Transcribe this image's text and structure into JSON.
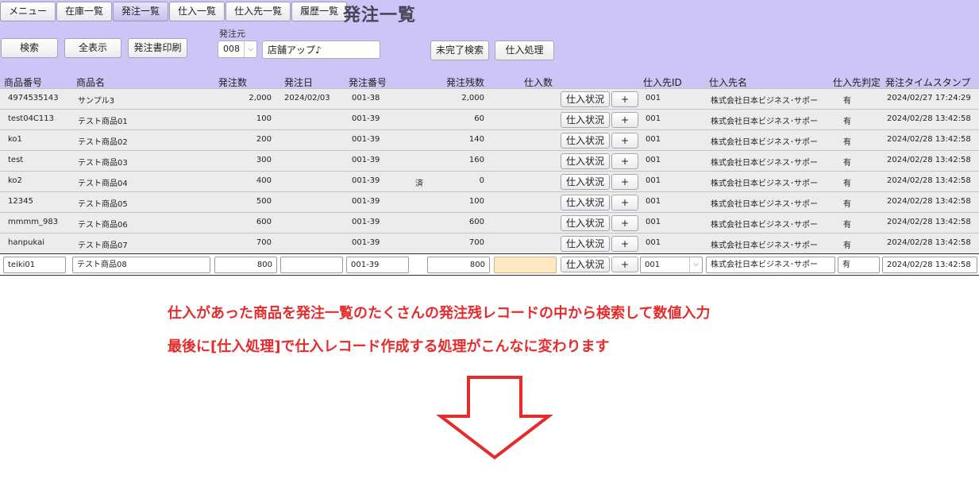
{
  "nav": {
    "tabs": [
      {
        "label": "メニュー"
      },
      {
        "label": "在庫一覧"
      },
      {
        "label": "発注一覧"
      },
      {
        "label": "仕入一覧"
      },
      {
        "label": "仕入先一覧"
      },
      {
        "label": "履歴一覧"
      }
    ]
  },
  "page": {
    "title": "発注一覧"
  },
  "toolbar": {
    "search": "検索",
    "show_all": "全表示",
    "print": "発注書印刷",
    "source_label": "発注元",
    "source_code": "008",
    "source_name": "店舗アップ♪",
    "incomplete_search": "未完了検索",
    "purchase_process": "仕入処理"
  },
  "columns": {
    "product_code": "商品番号",
    "product_name": "商品名",
    "order_qty": "発注数",
    "order_date": "発注日",
    "order_no": "発注番号",
    "remaining": "発注残数",
    "purchase_qty": "仕入数",
    "supplier_id": "仕入先ID",
    "supplier_name": "仕入先名",
    "supplier_flag": "仕入先判定",
    "timestamp": "発注タイムスタンプ"
  },
  "row_buttons": {
    "status": "仕入状況",
    "plus": "+"
  },
  "rows": [
    {
      "code": "4974535143",
      "name": "サンプル3",
      "qty": "2,000",
      "date": "2024/02/03",
      "order_no": "001-38",
      "done": "",
      "remain": "2,000",
      "sid": "001",
      "sname": "株式会社日本ビジネス･サポー",
      "flag": "有",
      "ts": "2024/02/27 17:24:29"
    },
    {
      "code": "test04C113",
      "name": "テスト商品01",
      "qty": "100",
      "date": "",
      "order_no": "001-39",
      "done": "",
      "remain": "60",
      "sid": "001",
      "sname": "株式会社日本ビジネス･サポー",
      "flag": "有",
      "ts": "2024/02/28 13:42:58"
    },
    {
      "code": "ko1",
      "name": "テスト商品02",
      "qty": "200",
      "date": "",
      "order_no": "001-39",
      "done": "",
      "remain": "140",
      "sid": "001",
      "sname": "株式会社日本ビジネス･サポー",
      "flag": "有",
      "ts": "2024/02/28 13:42:58"
    },
    {
      "code": "test",
      "name": "テスト商品03",
      "qty": "300",
      "date": "",
      "order_no": "001-39",
      "done": "",
      "remain": "160",
      "sid": "001",
      "sname": "株式会社日本ビジネス･サポー",
      "flag": "有",
      "ts": "2024/02/28 13:42:58"
    },
    {
      "code": "ko2",
      "name": "テスト商品04",
      "qty": "400",
      "date": "",
      "order_no": "001-39",
      "done": "済",
      "remain": "0",
      "sid": "001",
      "sname": "株式会社日本ビジネス･サポー",
      "flag": "有",
      "ts": "2024/02/28 13:42:58"
    },
    {
      "code": "12345",
      "name": "テスト商品05",
      "qty": "500",
      "date": "",
      "order_no": "001-39",
      "done": "",
      "remain": "100",
      "sid": "001",
      "sname": "株式会社日本ビジネス･サポー",
      "flag": "有",
      "ts": "2024/02/28 13:42:58"
    },
    {
      "code": "mmmm_983",
      "name": "テスト商品06",
      "qty": "600",
      "date": "",
      "order_no": "001-39",
      "done": "",
      "remain": "600",
      "sid": "001",
      "sname": "株式会社日本ビジネス･サポー",
      "flag": "有",
      "ts": "2024/02/28 13:42:58"
    },
    {
      "code": "hanpukai",
      "name": "テスト商品07",
      "qty": "700",
      "date": "",
      "order_no": "001-39",
      "done": "",
      "remain": "700",
      "sid": "001",
      "sname": "株式会社日本ビジネス･サポー",
      "flag": "有",
      "ts": "2024/02/28 13:42:58"
    }
  ],
  "edit_row": {
    "code": "teiki01",
    "name": "テスト商品08",
    "qty": "800",
    "date": "",
    "order_no": "001-39",
    "remain": "800",
    "purchase": "",
    "sid": "001",
    "sname": "株式会社日本ビジネス･サポー",
    "flag": "有",
    "ts": "2024/02/28 13:42:58"
  },
  "annotation": {
    "line1": "仕入があった商品を発注一覧のたくさんの発注残レコードの中から検索して数値入力",
    "line2": "最後に[仕入処理]で仕入レコード作成する処理がこんなに変わります",
    "color": "#e52b2b"
  },
  "colors": {
    "header_bg": "#ccc5f6",
    "row_bg": "#ececec",
    "highlight_input": "#ffe8c2"
  }
}
